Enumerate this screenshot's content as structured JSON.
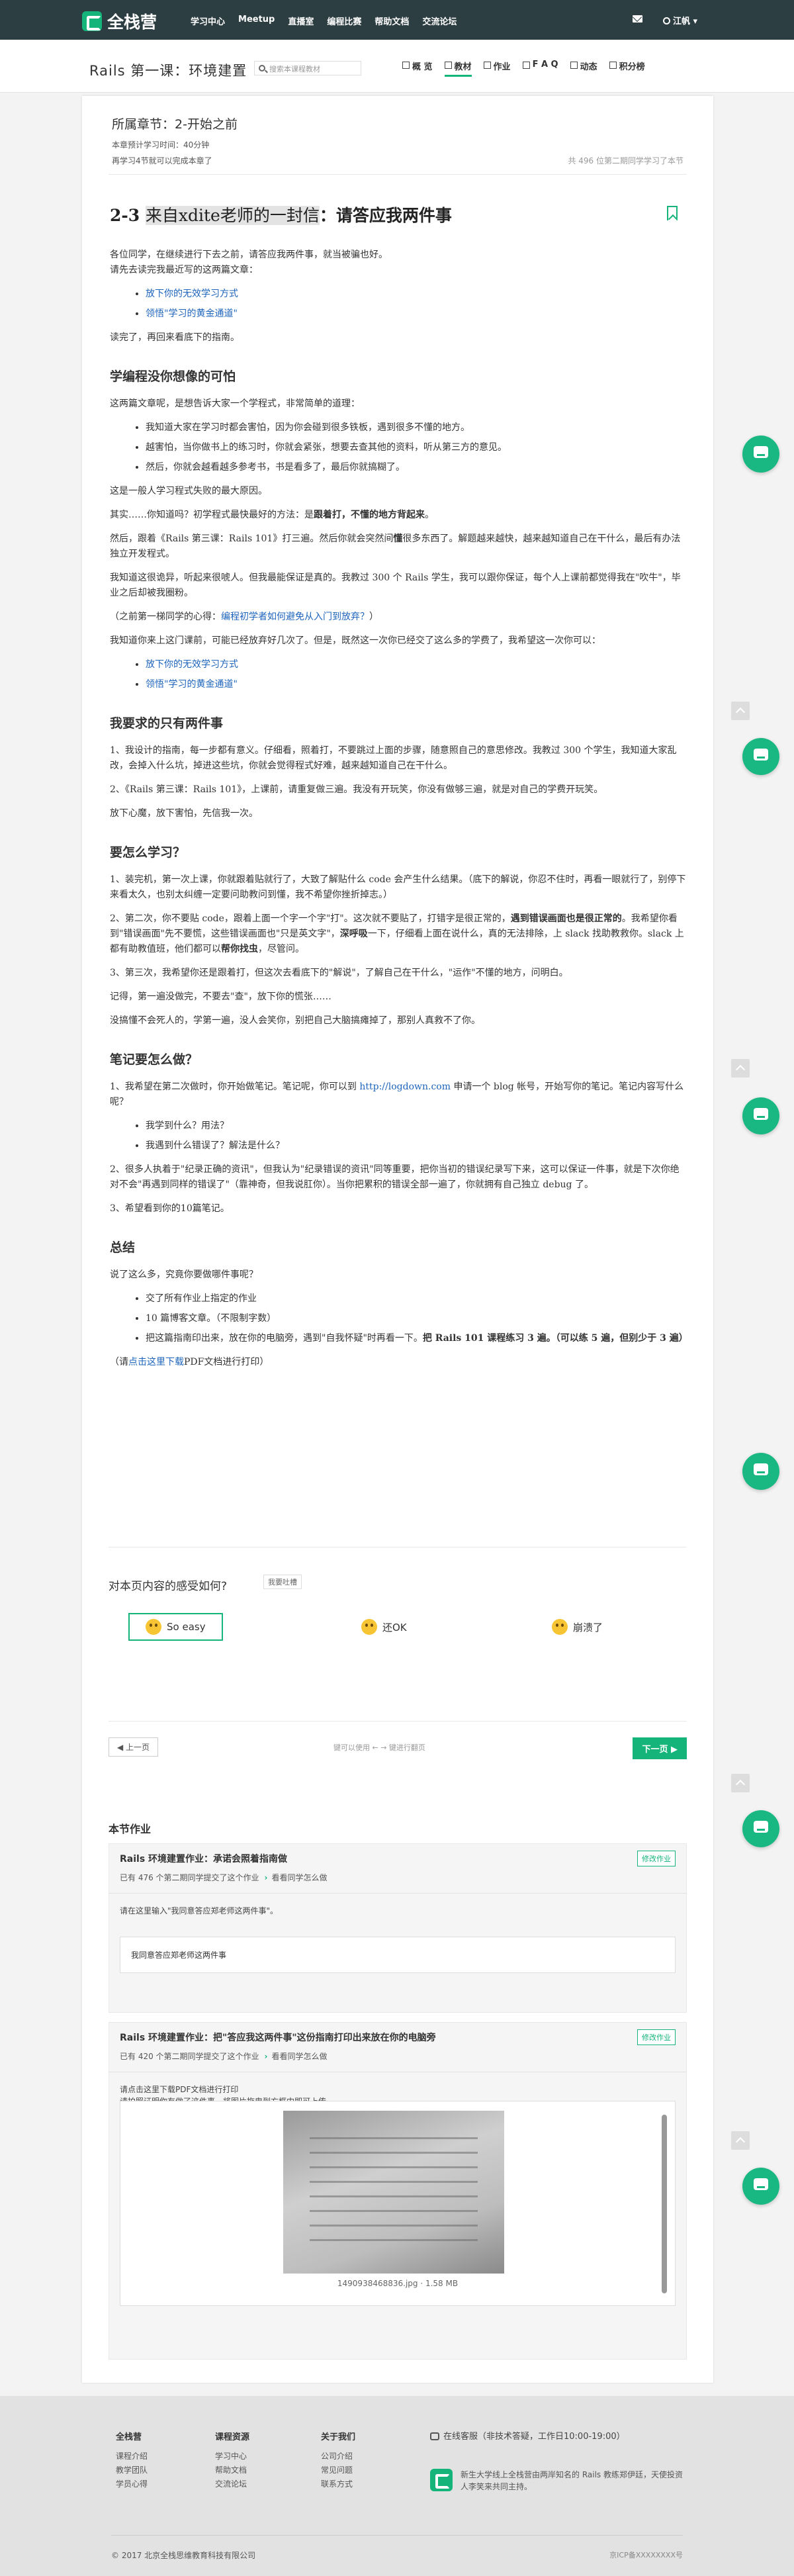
{
  "brand": {
    "name": "全栈营"
  },
  "topnav": [
    "学习中心",
    "Meetup",
    "直播室",
    "编程比赛",
    "帮助文档",
    "交流论坛"
  ],
  "user": {
    "name": "江帆 ▾"
  },
  "course": {
    "title": "Rails 第一课：环境建置",
    "search_placeholder": "搜索本课程教材"
  },
  "tabs": [
    {
      "label": "概 览",
      "icon": "home-icon"
    },
    {
      "label": "教材",
      "icon": "list-icon"
    },
    {
      "label": "作业",
      "icon": "file-icon"
    },
    {
      "label": "F A Q",
      "icon": "question-icon"
    },
    {
      "label": "动态",
      "icon": "activity-icon"
    },
    {
      "label": "积分榜",
      "icon": "star-icon"
    }
  ],
  "chapter": {
    "title": "所属章节：2-开始之前",
    "time": "本章预计学习时间：40分钟",
    "progress": "再学习4节就可以完成本章了",
    "learners": "共 496 位第二期同学学习了本节"
  },
  "article": {
    "h_num": "2-3",
    "h_hl": "来自xdite老师的一封信",
    "h_rest": "：请答应我两件事",
    "p1": "各位同学，在继续进行下去之前，请答应我两件事，就当被骗也好。",
    "p2": "请先去读完我最近写的这两篇文章：",
    "link_a": "放下你的无效学习方式",
    "link_b": "领悟\"学习的黄金通道\"",
    "p3": "读完了，再回来看底下的指南。",
    "h2_1": "学编程没你想像的可怕",
    "p4": "这两篇文章呢，是想告诉大家一个学程式，非常简单的道理：",
    "li1": "我知道大家在学习时都会害怕，因为你会碰到很多铁板，遇到很多不懂的地方。",
    "li2": "越害怕，当你做书上的练习时，你就会紧张，想要去查其他的资料，听从第三方的意见。",
    "li3": "然后，你就会越看越多参考书，书是看多了，最后你就搞糊了。",
    "p5": "这是一般人学习程式失败的最大原因。",
    "p6a": "其实……你知道吗？初学程式最快最好的方法：是",
    "p6b": "跟着打，不懂的地方背起来",
    "p6c": "。",
    "p7a": "然后，跟着《Rails 第三课：Rails 101》打三遍。然后你就会突然间",
    "p7b": "懂",
    "p7c": "很多东西了。解题越来越快，越来越知道自己在干什么，最后有办法独立开发程式。",
    "p8": "我知道这很诡异，听起来很唬人。但我最能保证是真的。我教过 300 个 Rails 学生，我可以跟你保证，每个人上课前都觉得我在\"吹牛\"，毕业之后却被我圈粉。",
    "p9a": "（之前第一梯同学的心得：",
    "p9link": "编程初学者如何避免从入门到放弃？",
    "p9b": "）",
    "p10": "我知道你来上这门课前，可能已经放弃好几次了。但是，既然这一次你已经交了这么多的学费了，我希望这一次你可以：",
    "h2_2": "我要求的只有两件事",
    "p11": "1、我设计的指南，每一步都有意义。仔细看，照着打，不要跳过上面的步骤，随意照自己的意思修改。我教过 300 个学生，我知道大家乱改，会掉入什么坑，掉进这些坑，你就会觉得程式好难，越来越知道自己在干什么。",
    "p12": "2、《Rails 第三课：Rails 101》，上课前，请重复做三遍。我没有开玩笑，你没有做够三遍，就是对自己的学费开玩笑。",
    "p13": "放下心魔，放下害怕，先信我一次。",
    "h2_3": "要怎么学习？",
    "p14": "1、装完机，第一次上课，你就跟着贴就行了，大致了解贴什么 code 会产生什么结果。（底下的解说，你忍不住时，再看一眼就行了，别停下来看太久，也别太纠缠一定要问助教问到懂，我不希望你挫折掉志。）",
    "p15a": "2、第二次，你不要贴 code，跟着上面一个字一个字\"打\"。这次就不要贴了，打错字是很正常的，",
    "p15b": "遇到错误画面也是很正常的",
    "p15c": "。我希望你看到\"错误画面\"先不要慌，这些错误画面也\"只是英文字\"，",
    "p15d": "深呼吸",
    "p15e": "一下，仔细看上面在说什么，真的无法排除，上 slack 找助教救你。slack 上都有助教值班，他们都可以",
    "p15f": "帮你找虫",
    "p15g": "，尽管问。",
    "p16": "3、第三次，我希望你还是跟着打，但这次去看底下的\"解说\"，了解自己在干什么，\"运作\"不懂的地方，问明白。",
    "p17": "记得，第一遍没做完，不要去\"查\"，放下你的慌张……",
    "p18": "没搞懂不会死人的，学第一遍，没人会笑你，别把自己大脑搞瘫掉了，那别人真救不了你。",
    "h2_4": "笔记要怎么做？",
    "p19a": "1、我希望在第二次做时，你开始做笔记。笔记呢，你可以到 ",
    "p19link": "http://logdown.com",
    "p19b": " 申请一个 blog 帐号，开始写你的笔记。笔记内容写什么呢？",
    "li4": "我学到什么？用法？",
    "li5": "我遇到什么错误了？解法是什么？",
    "p20": "2、很多人执着于\"纪录正确的资讯\"，但我认为\"纪录错误的资讯\"同等重要，把你当初的错误纪录写下来，这可以保证一件事，就是下次你绝对不会\"再遇到同样的错误了\"（靠神奇，但我说肛你）。当你把累积的错误全部一遍了，你就拥有自己独立 debug 了。",
    "p21": "3、希望看到你的10篇笔记。",
    "h2_5": "总结",
    "p22": "说了这么多，究竟你要做哪件事呢？",
    "li6": "交了所有作业上指定的作业",
    "li7": "10 篇博客文章。（不限制字数）",
    "li8a": "把这篇指南印出来，放在你的电脑旁，遇到\"自我怀疑\"时再看一下。",
    "li8b": "把 Rails 101 课程练习 3 遍。（可以练 5 遍，但别少于 3 遍）",
    "p23a": "（请",
    "p23link": "点击这里下载",
    "p23b": "PDF文档进行打印）"
  },
  "feedback": {
    "question": "对本页内容的感受如何?",
    "report": "我要吐槽",
    "options": [
      "So easy",
      "还OK",
      "崩溃了"
    ]
  },
  "pager": {
    "prev": "◀ 上一页",
    "hint": "键可以使用 ← → 键进行翻页",
    "next": "下一页 ▶"
  },
  "homework": {
    "title": "本节作业",
    "items": [
      {
        "title": "Rails 环境建置作业：承诺会照着指南做",
        "button": "修改作业",
        "count": "已有 476 个第二期同学提交了这个作业",
        "link": "看看同学怎么做",
        "prompt": "请在这里输入\"我同意答应郑老师这两件事\"。",
        "answer": "我同意答应郑老师这两件事"
      },
      {
        "title": "Rails 环境建置作业：把\"答应我这两件事\"这份指南打印出来放在你的电脑旁",
        "button": "修改作业",
        "count": "已有 420 个第二期同学提交了这个作业",
        "link": "看看同学怎么做",
        "prompt1": "请点击这里下载PDF文档进行打印",
        "prompt2": "请拍照证明你有做了这件事，将图片拖曳到方框内即可上传。",
        "file": "1490938468836.jpg · 1.58 MB"
      }
    ]
  },
  "footer": {
    "col1": {
      "title": "全栈营",
      "items": [
        "课程介绍",
        "教学团队",
        "学员心得"
      ]
    },
    "col2": {
      "title": "课程资源",
      "items": [
        "学习中心",
        "帮助文档",
        "交流论坛"
      ]
    },
    "col3": {
      "title": "关于我们",
      "items": [
        "公司介绍",
        "常见问题",
        "联系方式"
      ]
    },
    "contact": "在线客服（非技术答疑，工作日10:00-19:00）",
    "desc": "新生大学线上全栈营由两岸知名的 Rails 教练郑伊廷，天使投资人李笑来共同主持。",
    "copyright": "© 2017 北京全栈思维教育科技有限公司",
    "icp": "京ICP备XXXXXXXX号"
  },
  "colors": {
    "accent": "#14b47a",
    "topbar": "#2d3e42",
    "link": "#1d64bc"
  }
}
